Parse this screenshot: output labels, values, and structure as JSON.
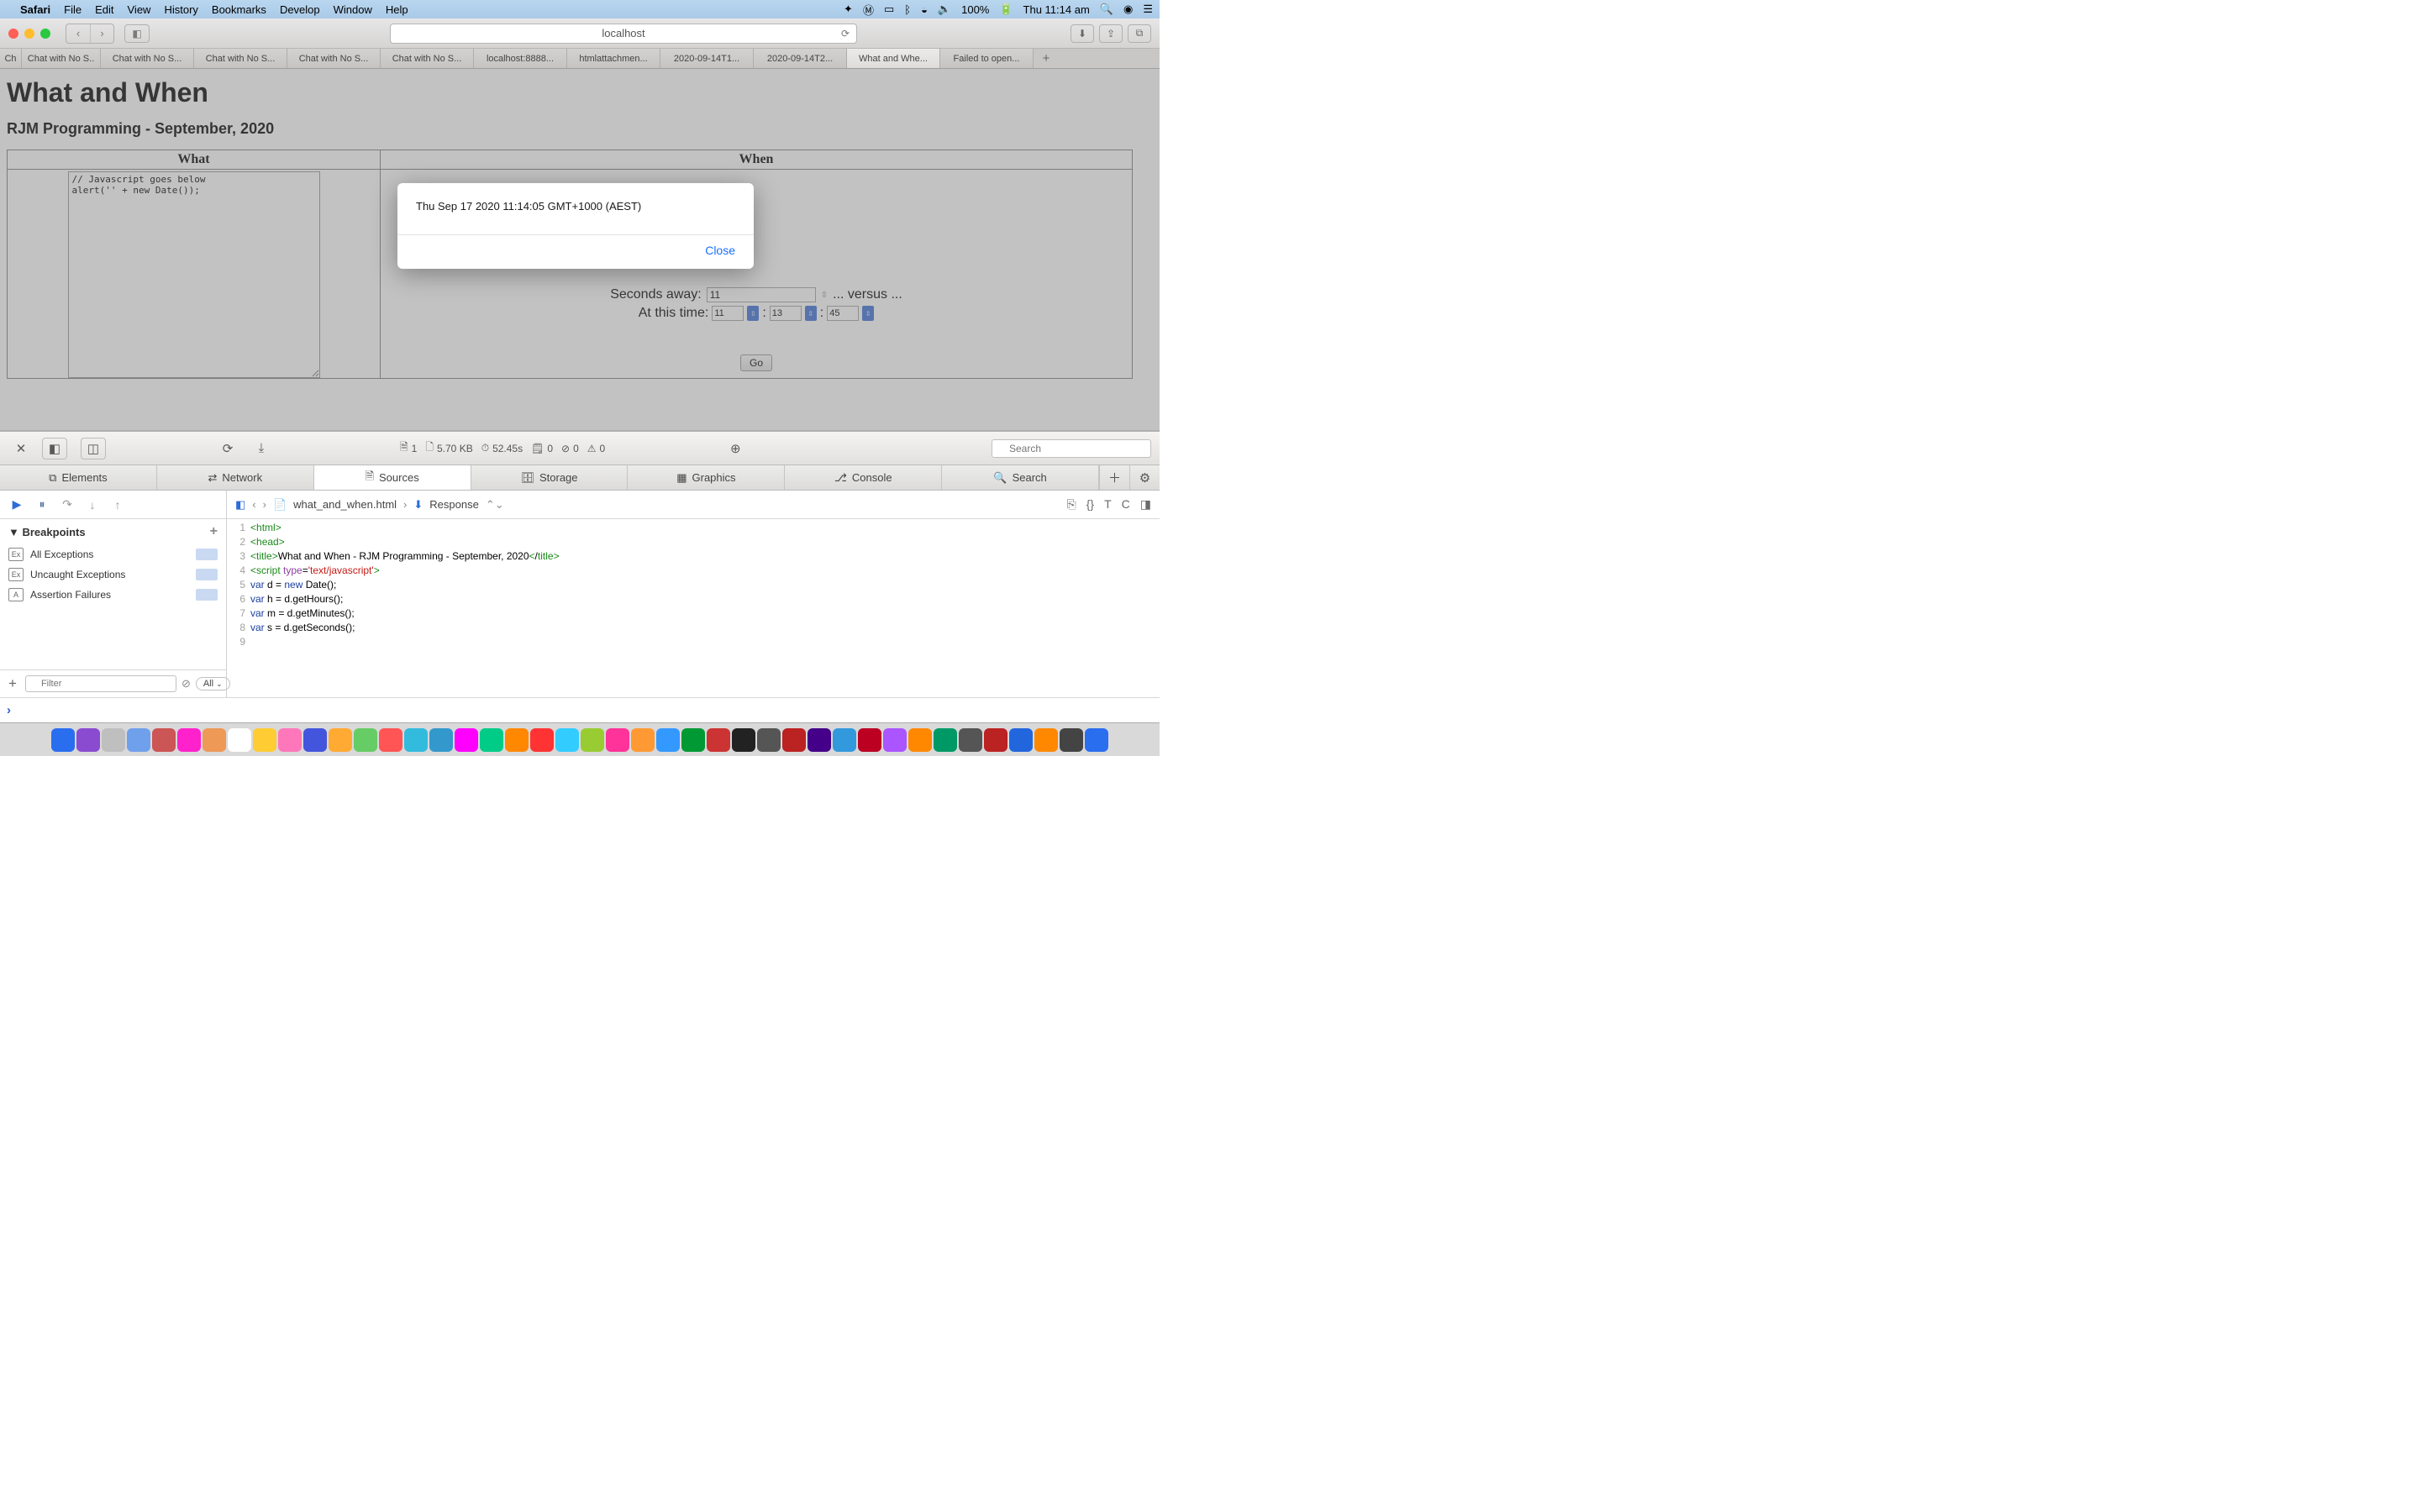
{
  "menubar": {
    "app": "Safari",
    "items": [
      "File",
      "Edit",
      "View",
      "History",
      "Bookmarks",
      "Develop",
      "Window",
      "Help"
    ],
    "battery": "100%",
    "clock": "Thu 11:14 am"
  },
  "toolbar": {
    "url": "localhost"
  },
  "tabs": [
    {
      "label": "Ch",
      "w": 26
    },
    {
      "label": "Chat with No S..",
      "w": 94
    },
    {
      "label": "Chat with No S...",
      "w": 111
    },
    {
      "label": "Chat with No S...",
      "w": 111
    },
    {
      "label": "Chat with No S...",
      "w": 111
    },
    {
      "label": "Chat with No S...",
      "w": 111
    },
    {
      "label": "localhost:8888...",
      "w": 111
    },
    {
      "label": "htmlattachmen...",
      "w": 111
    },
    {
      "label": "2020-09-14T1...",
      "w": 111
    },
    {
      "label": "2020-09-14T2...",
      "w": 111
    },
    {
      "label": "What and Whe...",
      "w": 111,
      "active": true
    },
    {
      "label": "Failed to open...",
      "w": 111
    }
  ],
  "page": {
    "h1": "What and When",
    "h3": "RJM Programming - September, 2020",
    "th_what": "What",
    "th_when": "When",
    "code": "// Javascript goes below\nalert('' + new Date());",
    "seconds_away_label": "Seconds away:",
    "seconds_away_value": "11",
    "versus": "... versus ...",
    "at_time_label": "At this time:",
    "hh": "11",
    "mm": "13",
    "ss": "45",
    "go": "Go"
  },
  "alert": {
    "message": "Thu Sep 17 2020 11:14:05 GMT+1000 (AEST)",
    "close": "Close"
  },
  "devtools": {
    "resource_count": "1",
    "size": "5.70 KB",
    "time": "52.45s",
    "log0a": "0",
    "log0b": "0",
    "log0c": "0",
    "search_placeholder": "Search",
    "tabs": [
      "Elements",
      "Network",
      "Sources",
      "Storage",
      "Graphics",
      "Console",
      "Search"
    ],
    "active_tab_index": 2,
    "breadcrumb_file": "what_and_when.html",
    "breadcrumb_mode": "Response",
    "breakpoints_header": "Breakpoints",
    "bp_items": [
      "All Exceptions",
      "Uncaught Exceptions",
      "Assertion Failures"
    ],
    "filter_placeholder": "Filter",
    "all_label": "All",
    "source_lines": [
      "<html>",
      "<head>",
      "<title>What and When - RJM Programming - September, 2020</title>",
      "<script type='text/javascript'>",
      "    var d = new Date();",
      "    var h = d.getHours();",
      "    var m = d.getMinutes();",
      "    var s = d.getSeconds();",
      ""
    ]
  }
}
